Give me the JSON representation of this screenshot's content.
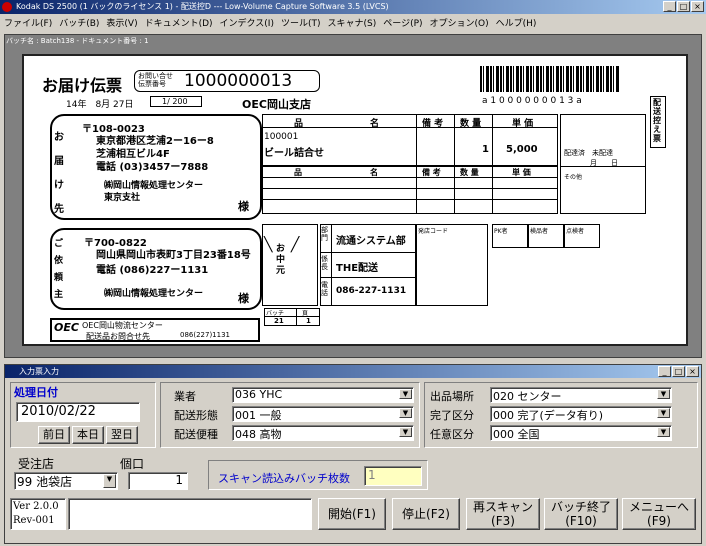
{
  "window": {
    "title": "Kodak DS 2500 (1 バックのライセンス 1) - 配送控D --- Low-Volume Capture Software 3.5 (LVCS)"
  },
  "menu": [
    "ファイル(F)",
    "バッチ(B)",
    "表示(V)",
    "ドキュメント(D)",
    "インデクス(I)",
    "ツール(T)",
    "スキャナ(S)",
    "ページ(P)",
    "オプション(O)",
    "ヘルプ(H)"
  ],
  "image_header": "バッチ名 : Batch138 - ドキュメント番号 : 1",
  "slip": {
    "title": "お届け伝票",
    "inquiry_label": "お問い合せ伝票番号",
    "number": "1000000013",
    "barcode_text": "a 1 0 0 0 0 0 0 0 1 3 a",
    "date": "14年　8月 27日",
    "count": "1/ 200",
    "branch": "OEC岡山支店",
    "side_tab": "配送控え票",
    "to_label": "お届け先",
    "to_zip": "〒108-0023",
    "to_addr1": "東京都港区芝浦2ー16ー8",
    "to_addr2": "芝浦相互ビル4F",
    "to_tel": "電話 (03)3457ー7888",
    "to_name1": "㈱岡山情報処理センター",
    "to_name2": "東京支社",
    "sama": "様",
    "from_label": "ご依頼主",
    "from_zip": "〒700-0822",
    "from_addr": "岡山県岡山市表町3丁目23番18号",
    "from_tel": "電話 (086)227ー1131",
    "from_name": "㈱岡山情報処理センター",
    "item_header": [
      "品",
      "名",
      "備 考",
      "数 量",
      "単 価"
    ],
    "item_code": "100001",
    "item_name": "ビール詰合せ",
    "item_qty": "1",
    "item_price": "5,000",
    "ochugen": "お中元",
    "dept_labels": [
      "部門",
      "係長",
      "電話"
    ],
    "dept_name": "流通システム部",
    "dept_chief": "THE配送",
    "dept_tel": "086-227-1131",
    "status1": "配達済　未配達",
    "status2": "月　　日",
    "other": "その他",
    "store_code": "発店コード",
    "pk": "PK者",
    "checker": "検品者",
    "confirmer": "点検者",
    "batch_label": "バッチ",
    "page_label": "頁",
    "batch_no": "21",
    "page_no": "1",
    "oec_logo": "OEC",
    "oec_center": "OEC岡山物流センター",
    "oec_inquiry": "配送品お問合せ先",
    "oec_tel": "086(227)1131"
  },
  "form": {
    "title": "入力票入力",
    "date_label": "処理日付",
    "date_value": "2010/02/22",
    "btn_prev": "前日",
    "btn_today": "本日",
    "btn_next": "翌日",
    "gyosha_label": "業者",
    "gyosha_value": "036 YHC",
    "haiso_keitai_label": "配送形態",
    "haiso_keitai_value": "001 一般",
    "haiso_bin_label": "配送便種",
    "haiso_bin_value": "048 高物",
    "shukka_label": "出品場所",
    "shukka_value": "020 センター",
    "kanryo_label": "完了区分",
    "kanryo_value": "000 完了(データ有り)",
    "nini_label": "任意区分",
    "nini_value": "000 全国",
    "store_label": "受注店",
    "store_value": "99 池袋店",
    "kuchi_label": "個口",
    "kuchi_value": "1",
    "scan_label": "スキャン読込みバッチ枚数",
    "scan_value": "1",
    "version1": "Ver 2.0.0",
    "version2": "Rev-001",
    "btn_start": "開始(F1)",
    "btn_stop": "停止(F2)",
    "btn_rescan": "再スキャン\n(F3)",
    "btn_batch_end": "バッチ終了\n(F10)",
    "btn_menu": "メニューへ\n(F9)"
  }
}
